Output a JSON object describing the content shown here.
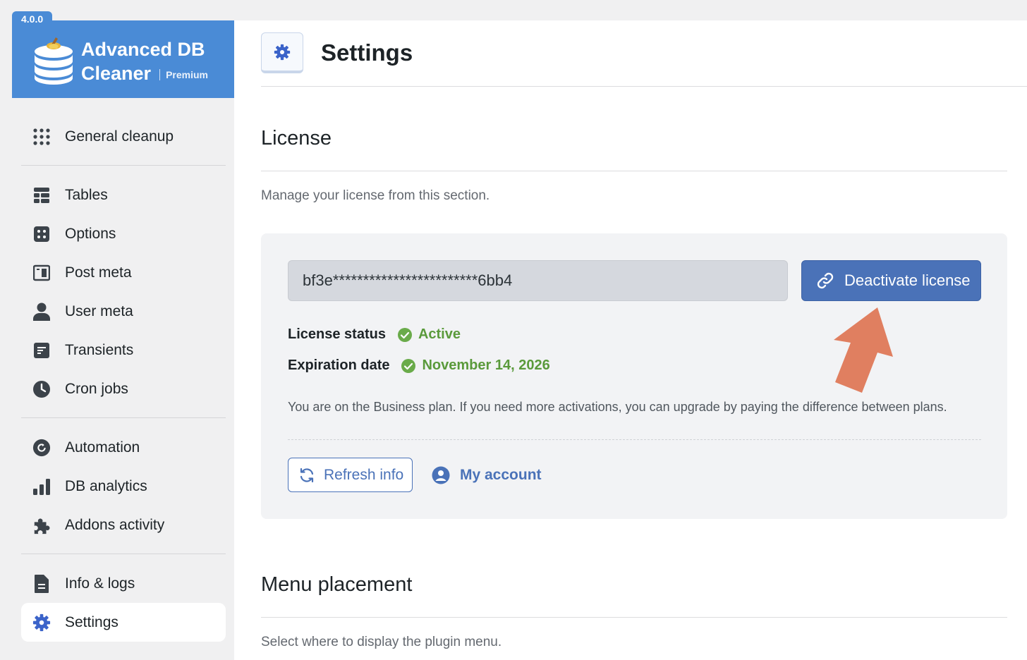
{
  "app": {
    "version": "4.0.0",
    "name_line1": "Advanced DB",
    "name_line2": "Cleaner",
    "edition": "Premium"
  },
  "sidebar": {
    "groups": [
      [
        {
          "label": "General cleanup",
          "icon": "grid-dots-icon"
        }
      ],
      [
        {
          "label": "Tables",
          "icon": "tables-icon"
        },
        {
          "label": "Options",
          "icon": "options-icon"
        },
        {
          "label": "Post meta",
          "icon": "post-meta-icon"
        },
        {
          "label": "User meta",
          "icon": "user-icon"
        },
        {
          "label": "Transients",
          "icon": "transients-icon"
        },
        {
          "label": "Cron jobs",
          "icon": "clock-icon"
        }
      ],
      [
        {
          "label": "Automation",
          "icon": "automation-icon"
        },
        {
          "label": "DB analytics",
          "icon": "bar-chart-icon"
        },
        {
          "label": "Addons activity",
          "icon": "puzzle-icon"
        }
      ],
      [
        {
          "label": "Info & logs",
          "icon": "document-icon"
        },
        {
          "label": "Settings",
          "icon": "gear-icon",
          "active": true
        }
      ]
    ]
  },
  "header": {
    "title": "Settings",
    "icon": "gear-icon"
  },
  "license_section": {
    "title": "License",
    "description": "Manage your license from this section.",
    "license_key": "bf3e************************6bb4",
    "deactivate_label": "Deactivate license",
    "status_label": "License status",
    "status_value": "Active",
    "expiration_label": "Expiration date",
    "expiration_value": "November 14, 2026",
    "plan_note": "You are on the Business plan. If you need more activations, you can upgrade by paying the difference between plans.",
    "refresh_label": "Refresh info",
    "account_label": "My account"
  },
  "menu_section": {
    "title": "Menu placement",
    "description": "Select where to display the plugin menu."
  },
  "colors": {
    "brand": "#4a8bd6",
    "primary_button": "#4a72b8",
    "success": "#5a9a3b",
    "annotation_arrow": "#e07f60"
  }
}
